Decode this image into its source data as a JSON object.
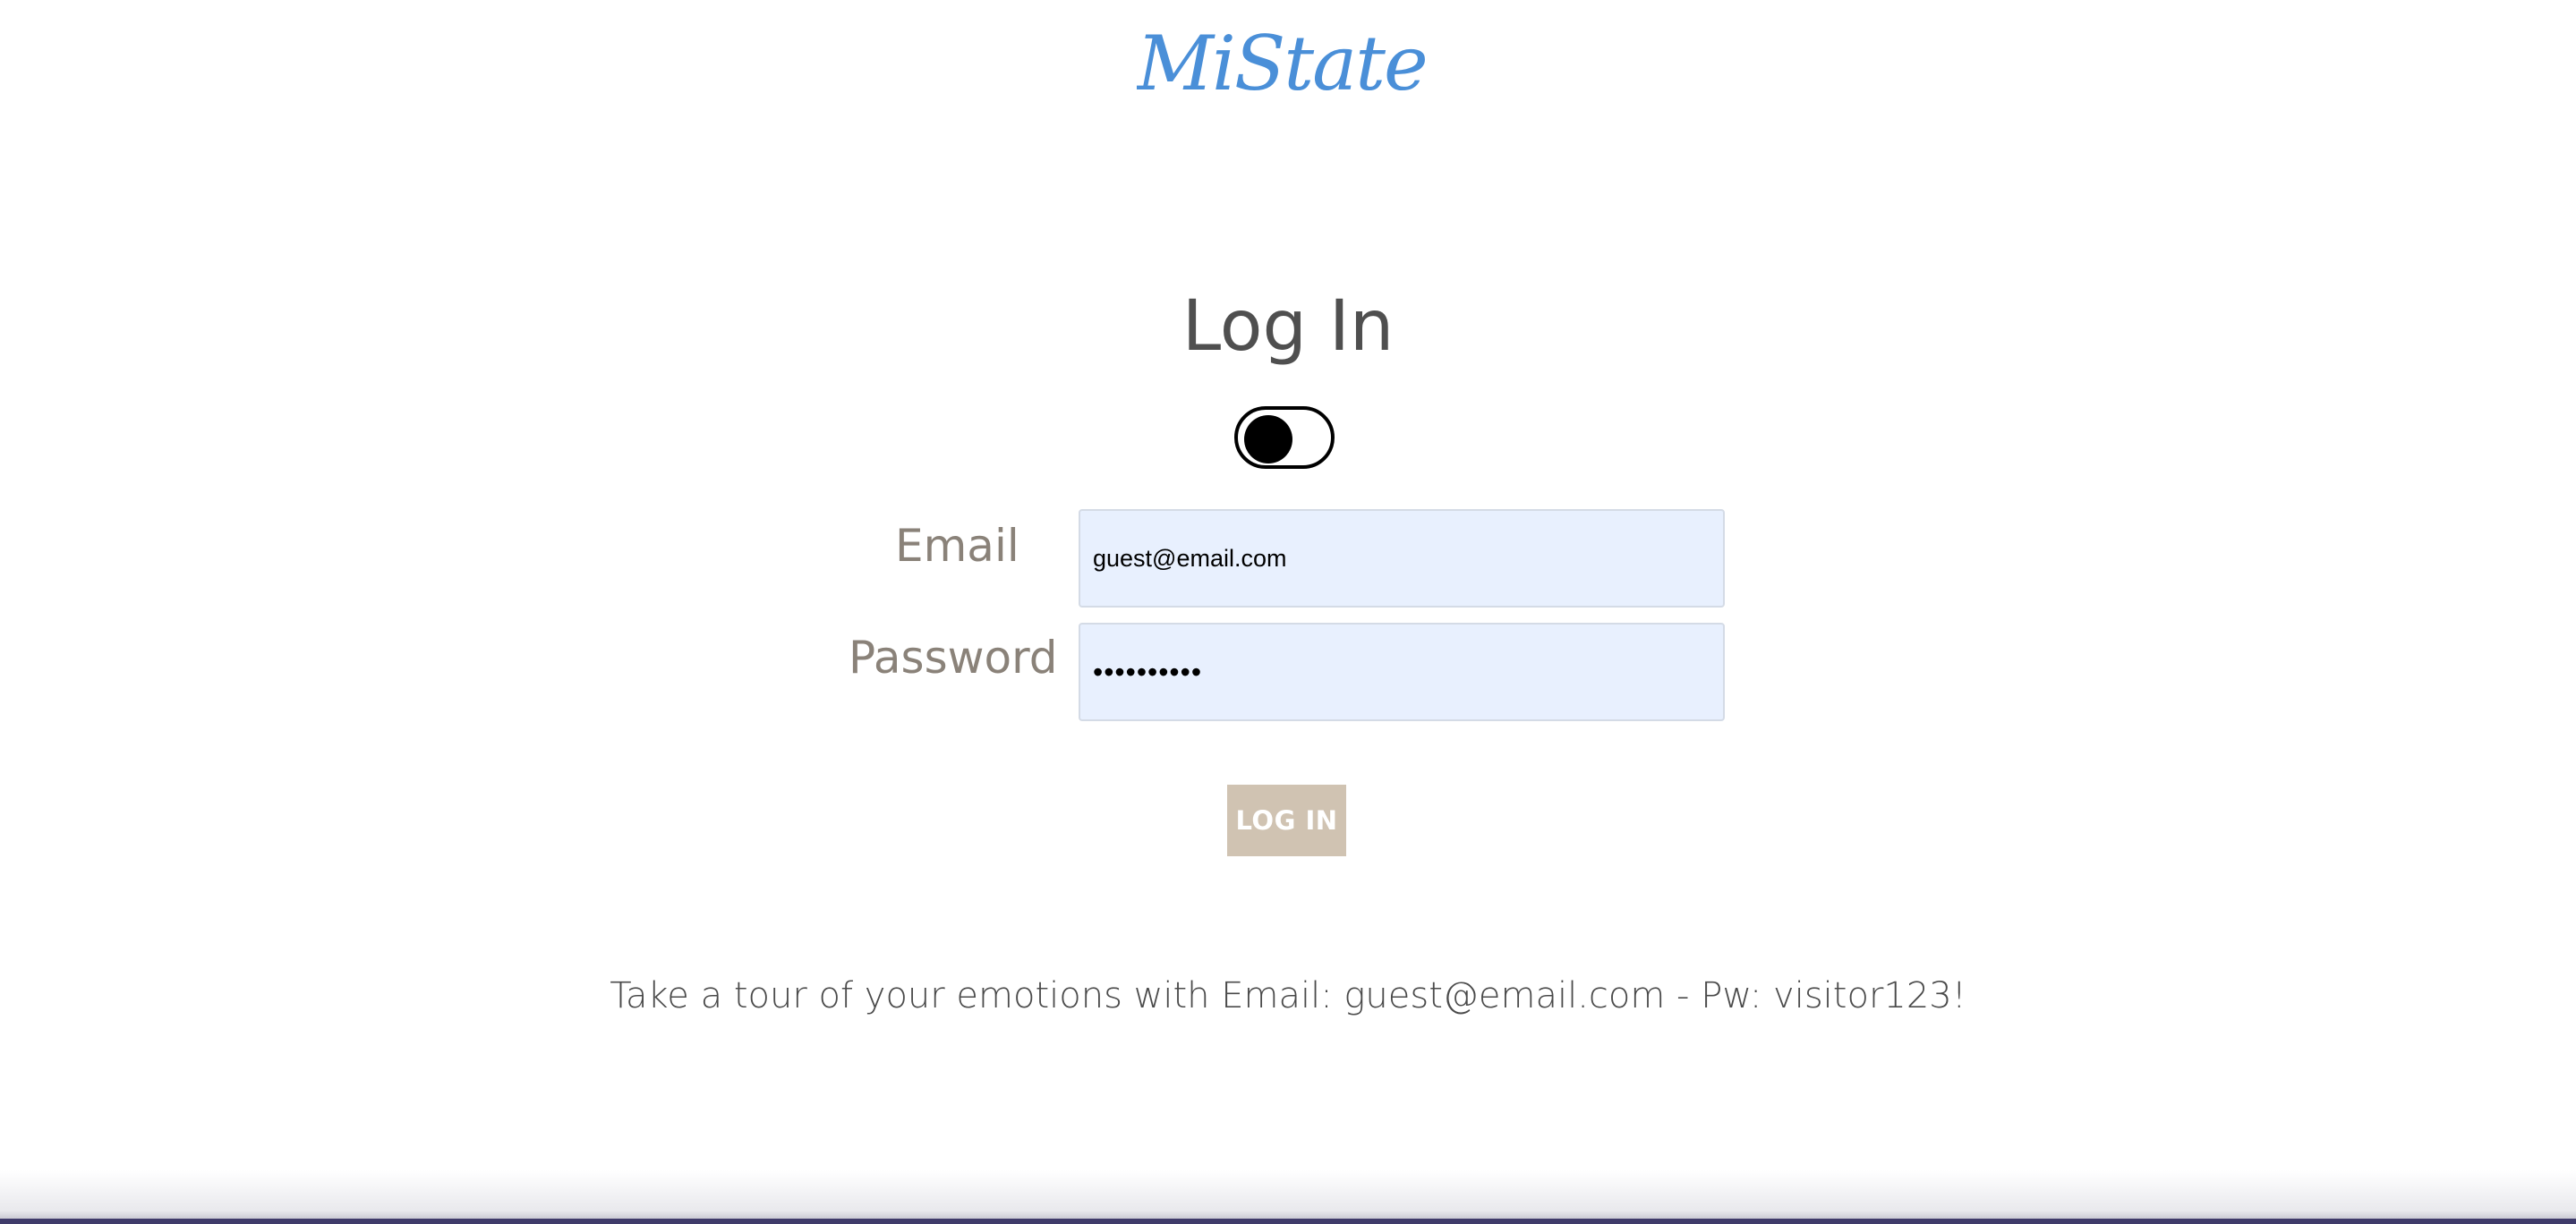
{
  "brand": {
    "logo_text": "MiState",
    "logo_color": "#4a8fd8"
  },
  "login": {
    "title": "Log In",
    "theme_toggle": {
      "state": "off",
      "icon": "toggle-switch"
    },
    "email_label": "Email",
    "email_value": "guest@email.com",
    "password_label": "Password",
    "password_value": "••••••••••",
    "submit_label": "LOG IN",
    "submit_color": "#d0c3b2"
  },
  "hint": {
    "text": "Take a tour of your emotions with Email: guest@email.com - Pw: visitor123!"
  },
  "colors": {
    "title": "#4f4f4f",
    "label": "#8a8279",
    "field_background": "#e8f0fe"
  }
}
